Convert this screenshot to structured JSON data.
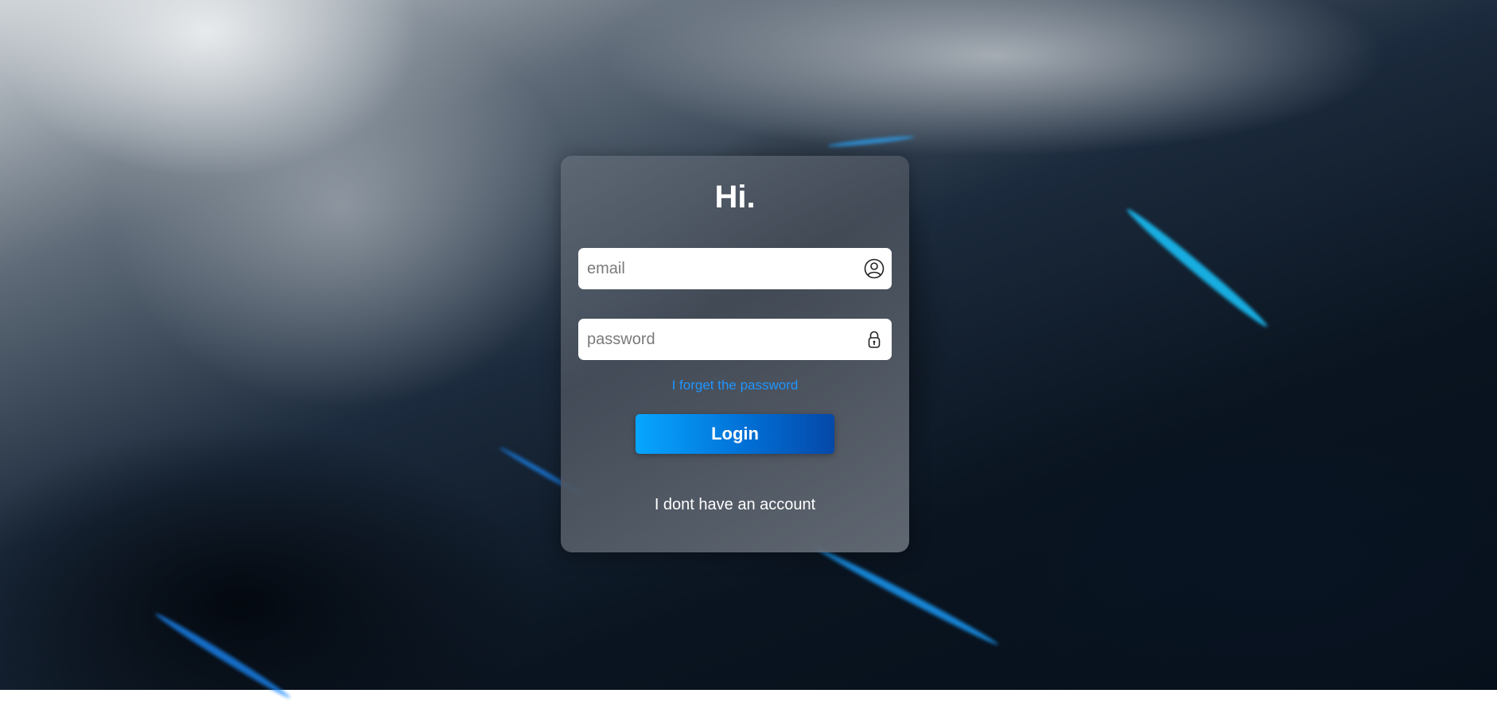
{
  "login": {
    "title": "Hi.",
    "email": {
      "placeholder": "email",
      "value": ""
    },
    "password": {
      "placeholder": "password",
      "value": ""
    },
    "forgot_link": "I forget the password",
    "login_button": "Login",
    "no_account_link": "I dont have an account"
  },
  "colors": {
    "accent": "#1e95ff",
    "button_start": "#07a6ff",
    "button_end": "#0548a8",
    "card": "#5f6976"
  },
  "icons": {
    "email_field": "user-icon",
    "password_field": "lock-icon"
  }
}
